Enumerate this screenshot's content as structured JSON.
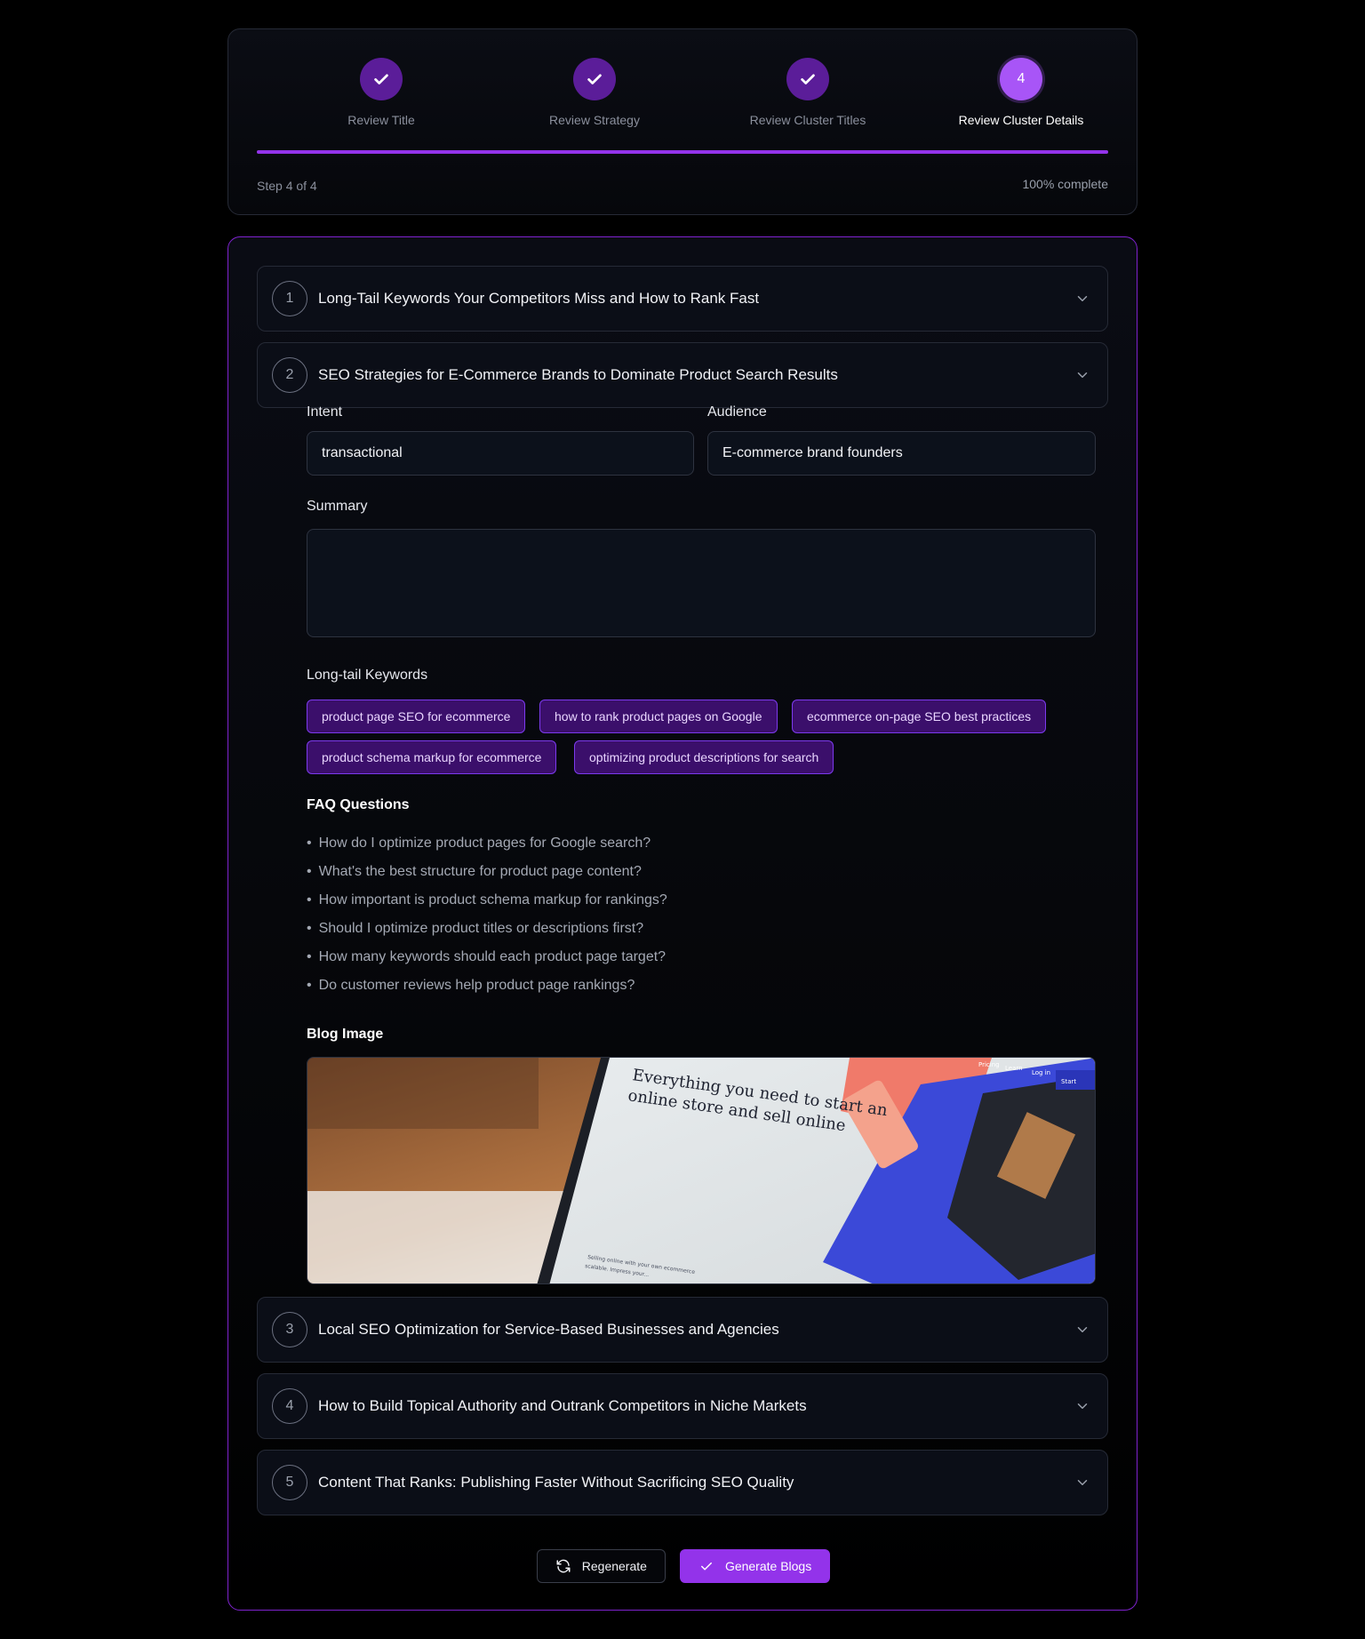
{
  "stepper": {
    "steps": [
      {
        "label": "Review Title",
        "state": "complete"
      },
      {
        "label": "Review Strategy",
        "state": "complete"
      },
      {
        "label": "Review Cluster Titles",
        "state": "complete"
      },
      {
        "label": "Review Cluster Details",
        "number": "4",
        "state": "active"
      }
    ],
    "step_count": "Step 4 of 4",
    "percent_text": "100% complete",
    "progress": 1.0
  },
  "clusters": [
    {
      "number": "1",
      "title": "Long-Tail Keywords Your Competitors Miss and How to Rank Fast"
    },
    {
      "number": "2",
      "title": "SEO Strategies for E-Commerce Brands to Dominate Product Search Results"
    },
    {
      "number": "3",
      "title": "Local SEO Optimization for Service-Based Businesses and Agencies"
    },
    {
      "number": "4",
      "title": "How to Build Topical Authority and Outrank Competitors in Niche Markets"
    },
    {
      "number": "5",
      "title": "Content That Ranks: Publishing Faster Without Sacrificing SEO Quality"
    }
  ],
  "details": {
    "intent_label": "Intent",
    "intent_value": "transactional",
    "audience_label": "Audience",
    "audience_value": "E-commerce brand founders",
    "summary_label": "Summary",
    "summary_value": "",
    "keywords_label": "Long-tail Keywords",
    "keywords": [
      "product page SEO for ecommerce",
      "how to rank product pages on Google",
      "ecommerce on-page SEO best practices",
      "product schema markup for ecommerce",
      "optimizing product descriptions for search"
    ],
    "faq_label": "FAQ Questions",
    "faqs": [
      "How do I optimize product pages for Google search?",
      "What's the best structure for product page content?",
      "How important is product schema markup for rankings?",
      "Should I optimize product titles or descriptions first?",
      "How many keywords should each product page target?",
      "Do customer reviews help product page rankings?"
    ],
    "image_label": "Blog Image",
    "image_text": {
      "headline_line1": "Everything you need to start an",
      "headline_line2": "online store and sell online",
      "nav_pricing": "Pricing",
      "nav_learn": "Learn",
      "nav_login": "Log in",
      "nav_start": "Start",
      "body_line1": "Selling online with your own ecommerce",
      "body_line2": "scalable. Impress your..."
    }
  },
  "actions": {
    "regenerate_label": "Regenerate",
    "generate_label": "Generate Blogs"
  },
  "colors": {
    "accent": "#9333ea",
    "accent_light": "#a855f7",
    "step_complete": "#5b1d99",
    "card_border": "#7e22ce"
  }
}
